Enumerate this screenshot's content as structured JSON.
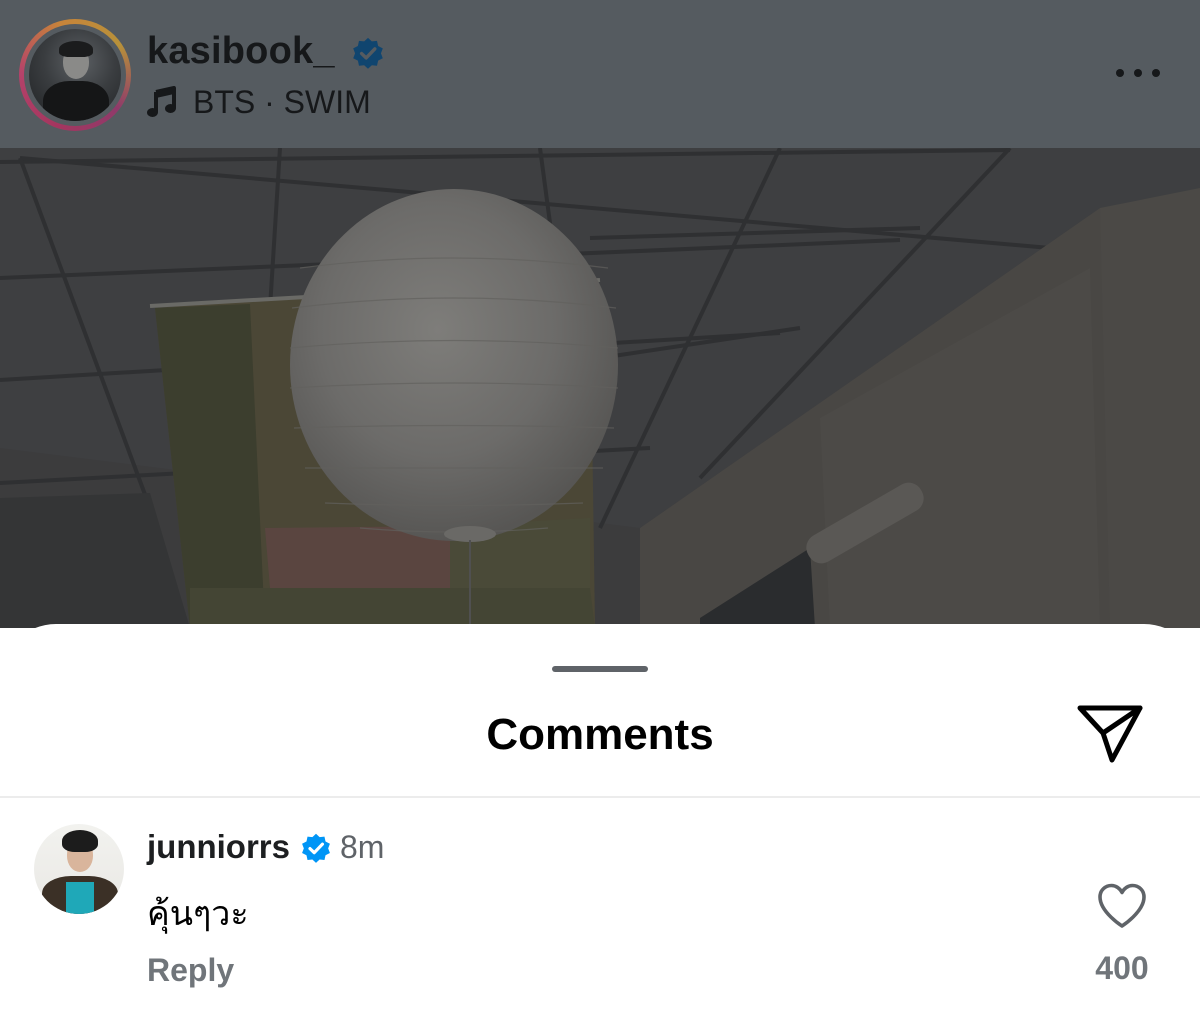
{
  "story_header": {
    "username": "kasibook_",
    "verified": true,
    "music_text": "BTS · SWIM",
    "icons": [
      "verified-badge-icon",
      "music-note-icon",
      "more-options-icon"
    ]
  },
  "comments_sheet": {
    "title": "Comments",
    "share_icon": "send-icon",
    "comments": [
      {
        "username": "junniorrs",
        "verified": true,
        "time": "8m",
        "text": "คุ้นๆวะ",
        "reply_label": "Reply",
        "like_icon": "heart-outline-icon",
        "like_count": "400"
      }
    ]
  },
  "colors": {
    "verified_blue": "#0095f6",
    "dim_overlay": "#555b60",
    "secondary_text": "#70757a"
  }
}
